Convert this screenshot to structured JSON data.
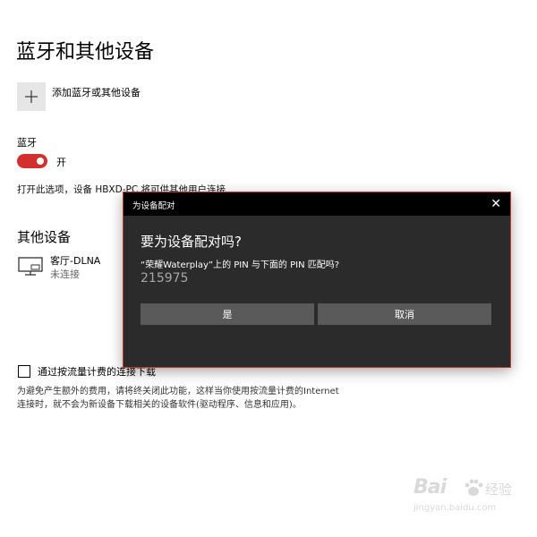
{
  "page": {
    "title": "蓝牙和其他设备",
    "add_device_label": "添加蓝牙或其他设备",
    "bluetooth_label": "蓝牙",
    "bluetooth_state": "开",
    "discoverable_desc": "打开此选项，设备 HBXD-PC 将可供其他用户连接",
    "other_devices_title": "其他设备",
    "devices": [
      {
        "name": "客厅-DLNA",
        "status": "未连接",
        "icon": "tv-display-icon"
      }
    ],
    "metered_label": "通过按流量计费的连接下载",
    "metered_desc": "为避免产生额外的费用，请将终关闭此功能，这样当你使用按流量计费的Internet 连接时，就不会为新设备下载相关的设备软件(驱动程序、信息和应用)。"
  },
  "dialog": {
    "titlebar": "为设备配对",
    "close_glyph": "✕",
    "heading": "要为设备配对吗?",
    "question": "“荣耀Waterplay”上的 PIN 与下面的 PIN 匹配吗?",
    "pin": "215975",
    "yes_label": "是",
    "cancel_label": "取消"
  },
  "watermark": {
    "brand": "Bai",
    "jingyan": "经验",
    "url": "jingyan.baidu.com"
  },
  "colors": {
    "toggle_on": "#d32f2f",
    "dialog_bg": "#2b2b2b",
    "dialog_border": "#c0392b",
    "dialog_button": "#5a5a5a"
  }
}
